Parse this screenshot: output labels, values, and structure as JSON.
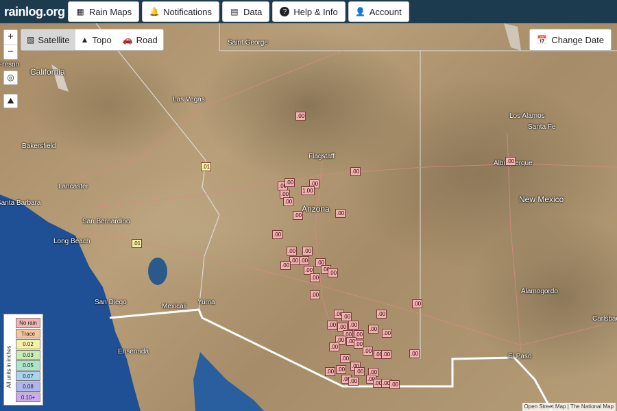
{
  "app": {
    "logo_text": "rainlog.org"
  },
  "nav": [
    {
      "label": "Rain Maps",
      "icon": "map-icon"
    },
    {
      "label": "Notifications",
      "icon": "bell-icon"
    },
    {
      "label": "Data",
      "icon": "chart-icon"
    },
    {
      "label": "Help & Info",
      "icon": "help-icon"
    },
    {
      "label": "Account",
      "icon": "user-icon"
    }
  ],
  "map_types": [
    {
      "label": "Satellite",
      "icon": "image-icon",
      "active": true
    },
    {
      "label": "Topo",
      "icon": "mountain-icon",
      "active": false
    },
    {
      "label": "Road",
      "icon": "car-icon",
      "active": false
    }
  ],
  "controls": {
    "zoom_in": "+",
    "zoom_out": "−",
    "change_date": "Change Date"
  },
  "places": [
    "Saint George",
    "Fresno",
    "California",
    "Las Vegas",
    "Bakersfield",
    "Lancaster",
    "Santa Barbara",
    "San Bernardino",
    "Long Beach",
    "San Diego",
    "Mexicali",
    "Yuma",
    "Ensenada",
    "Flagstaff",
    "Arizona",
    "Albuquerque",
    "Los Alamos",
    "Santa Fe",
    "New Mexico",
    "Alamogordo",
    "Carlsbad",
    "El Paso"
  ],
  "gauge_readings": [
    ".00",
    ".01",
    ".01",
    ".00",
    ".00",
    ".00",
    ".00",
    ".00",
    ".00",
    "1.00",
    ".00",
    ".00",
    ".00",
    ".00",
    ".00",
    ".00",
    ".00",
    ".00",
    ".00",
    ".00",
    ".00",
    ".00",
    ".00",
    ".00",
    ".00",
    ".00",
    ".00",
    ".00",
    ".00",
    ".00",
    ".00",
    ".00",
    ".00",
    ".00",
    ".00",
    ".00",
    ".00",
    ".00",
    ".00",
    ".00",
    ".00",
    ".00",
    ".00",
    ".00",
    ".00",
    ".00",
    ".00",
    ".00",
    ".00",
    ".00",
    ".00",
    ".00",
    ".00",
    ".00",
    ".00",
    ".00"
  ],
  "legend": {
    "title": "All units in inches",
    "items": [
      {
        "label": "No rain",
        "color": "#f2b3b3"
      },
      {
        "label": "Trace",
        "color": "#f6c59b"
      },
      {
        "label": "0.02",
        "color": "#f5f2a8"
      },
      {
        "label": "0.03",
        "color": "#c9ecb0"
      },
      {
        "label": "0.05",
        "color": "#a8e8c8"
      },
      {
        "label": "0.07",
        "color": "#a9d3ef"
      },
      {
        "label": "0.08",
        "color": "#b0b6ef"
      },
      {
        "label": "0.10+",
        "color": "#cfa9ef"
      }
    ]
  },
  "attribution": "Open Street Map | The National Map"
}
